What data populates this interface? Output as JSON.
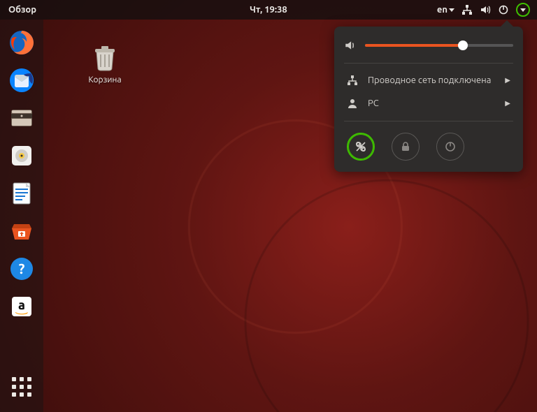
{
  "topbar": {
    "activities": "Обзор",
    "clock": "Чт, 19:38",
    "language": "en"
  },
  "desktop": {
    "trash_label": "Корзина"
  },
  "system_menu": {
    "network_label": "Проводное сеть подключена",
    "user_label": "PC"
  }
}
